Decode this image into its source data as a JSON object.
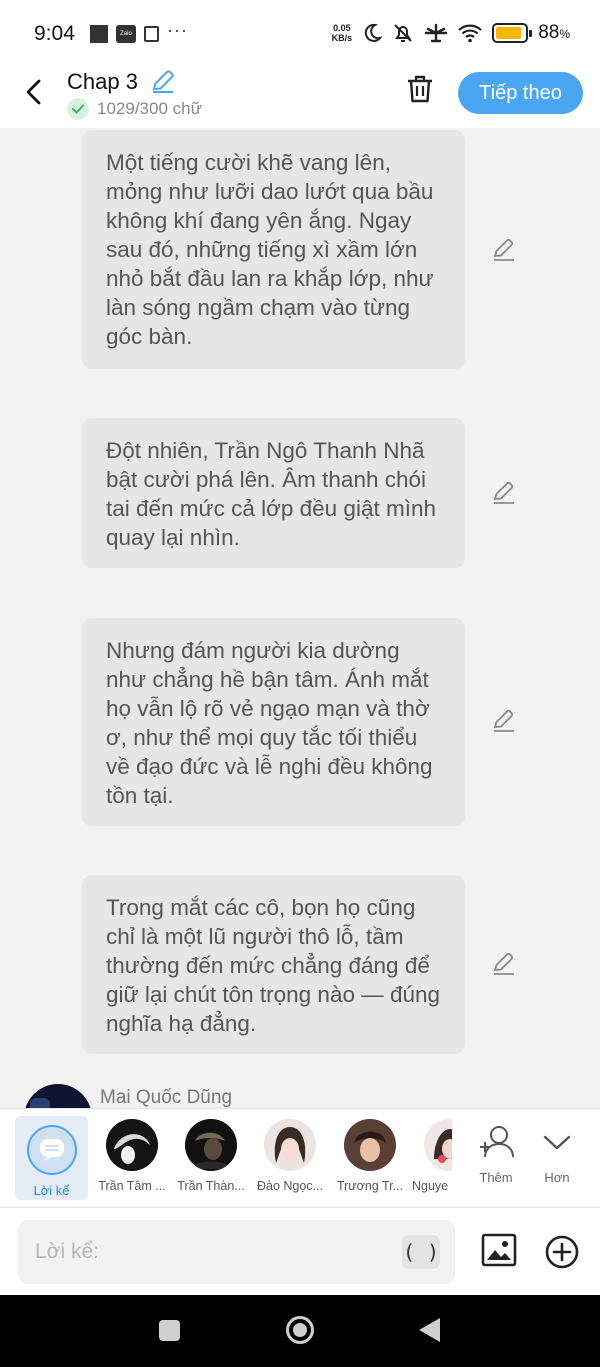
{
  "status_bar": {
    "time": "9:04",
    "zalo_label": "Zalo",
    "more": "···",
    "speed_value": "0.05",
    "speed_unit": "KB/s",
    "battery_percent": "88",
    "battery_unit": "%",
    "battery_level": 0.88,
    "battery_color": "#f6b500"
  },
  "header": {
    "title": "Chap 3",
    "word_count": "1029/300 chữ",
    "next_label": "Tiếp theo",
    "accent_color": "#4ba6f2"
  },
  "messages": [
    {
      "text": "Một tiếng cười khẽ vang lên, mỏng như lưỡi dao lướt qua bầu không khí đang yên ắng. Ngay sau đó, những tiếng xì xầm lớn nhỏ bắt đầu lan ra khắp lớp, như làn sóng ngầm chạm vào từng góc bàn."
    },
    {
      "text": "Đột nhiên, Trần Ngô Thanh Nhã bật cười phá lên. Âm thanh chói tai đến mức cả lớp đều giật mình quay lại nhìn."
    },
    {
      "text": "Nhưng đám người kia dường như chẳng hề bận tâm. Ánh mắt họ vẫn lộ rõ vẻ ngạo mạn và thờ ơ, như thể mọi quy tắc tối thiểu về đạo đức và lễ nghi đều không tồn tại."
    },
    {
      "text": "Trong mắt các cô, bọn họ cũng chỉ là một lũ người thô lỗ, tầm thường đến mức chẳng đáng để giữ lại chút tôn trọng nào — đúng nghĩa hạ đẳng."
    }
  ],
  "author": {
    "name": "Mai Quốc Dũng"
  },
  "characters": {
    "narrator_label": "Lời kể",
    "items": [
      {
        "name": "Trần Tâm ..."
      },
      {
        "name": "Trần Thàn..."
      },
      {
        "name": "Đào Ngọc..."
      },
      {
        "name": "Trương Tr..."
      },
      {
        "name": "Nguye"
      }
    ],
    "add_label": "Thêm",
    "more_label": "Hơn"
  },
  "composer": {
    "placeholder": "Lời kể:",
    "paren_label": "( )"
  },
  "icons": {
    "back": "chevron-left-icon",
    "edit": "pencil-icon",
    "check": "check-circle-icon",
    "delete": "trash-icon",
    "image": "image-icon",
    "add": "plus-circle-icon",
    "person_add": "person-add-icon",
    "expand": "chevron-down-icon"
  }
}
